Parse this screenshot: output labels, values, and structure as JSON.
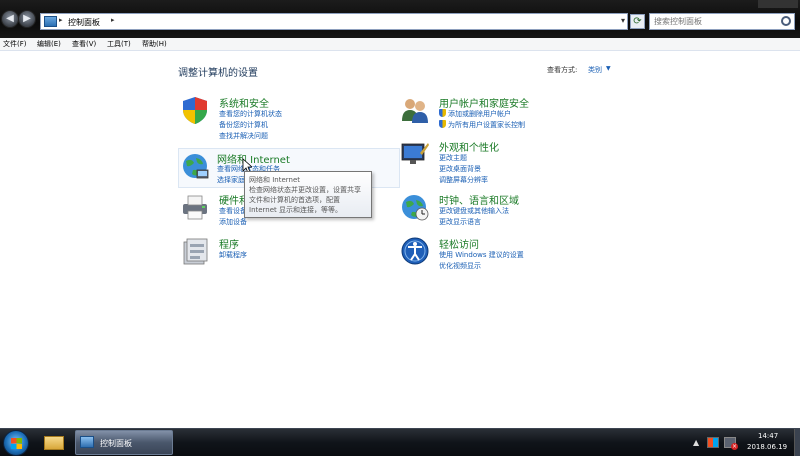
{
  "address": {
    "crumbs": [
      "控制面板"
    ]
  },
  "search": {
    "placeholder": "搜索控制面板"
  },
  "menu": [
    "文件(F)",
    "编辑(E)",
    "查看(V)",
    "工具(T)",
    "帮助(H)"
  ],
  "page": {
    "title": "调整计算机的设置",
    "viewby_label": "查看方式:",
    "viewby_value": "类别"
  },
  "categories": [
    {
      "title": "系统和安全",
      "links": [
        "查看您的计算机状态",
        "备份您的计算机",
        "查找并解决问题"
      ]
    },
    {
      "title": "网络和 Internet",
      "links": [
        "查看网络状态和任务",
        "选择家庭组和共享选项"
      ]
    },
    {
      "title": "硬件和声音",
      "links": [
        "查看设备和打印机",
        "添加设备"
      ]
    },
    {
      "title": "程序",
      "links": [
        "卸载程序"
      ]
    },
    {
      "title": "用户帐户和家庭安全",
      "links": [
        "添加或删除用户帐户",
        "为所有用户设置家长控制"
      ]
    },
    {
      "title": "外观和个性化",
      "links": [
        "更改主题",
        "更改桌面背景",
        "调整屏幕分辨率"
      ]
    },
    {
      "title": "时钟、语言和区域",
      "links": [
        "更改键盘或其他输入法",
        "更改显示语言"
      ]
    },
    {
      "title": "轻松访问",
      "links": [
        "使用 Windows 建议的设置",
        "优化视频显示"
      ]
    }
  ],
  "tooltip": {
    "title": "网络和 Internet",
    "body": "检查网络状态并更改设置，设置共享文件和计算机的首选项，配置 Internet 显示和连接，等等。"
  },
  "taskbar": {
    "active_window": "控制面板",
    "time": "14:47",
    "date": "2018.06.19"
  }
}
